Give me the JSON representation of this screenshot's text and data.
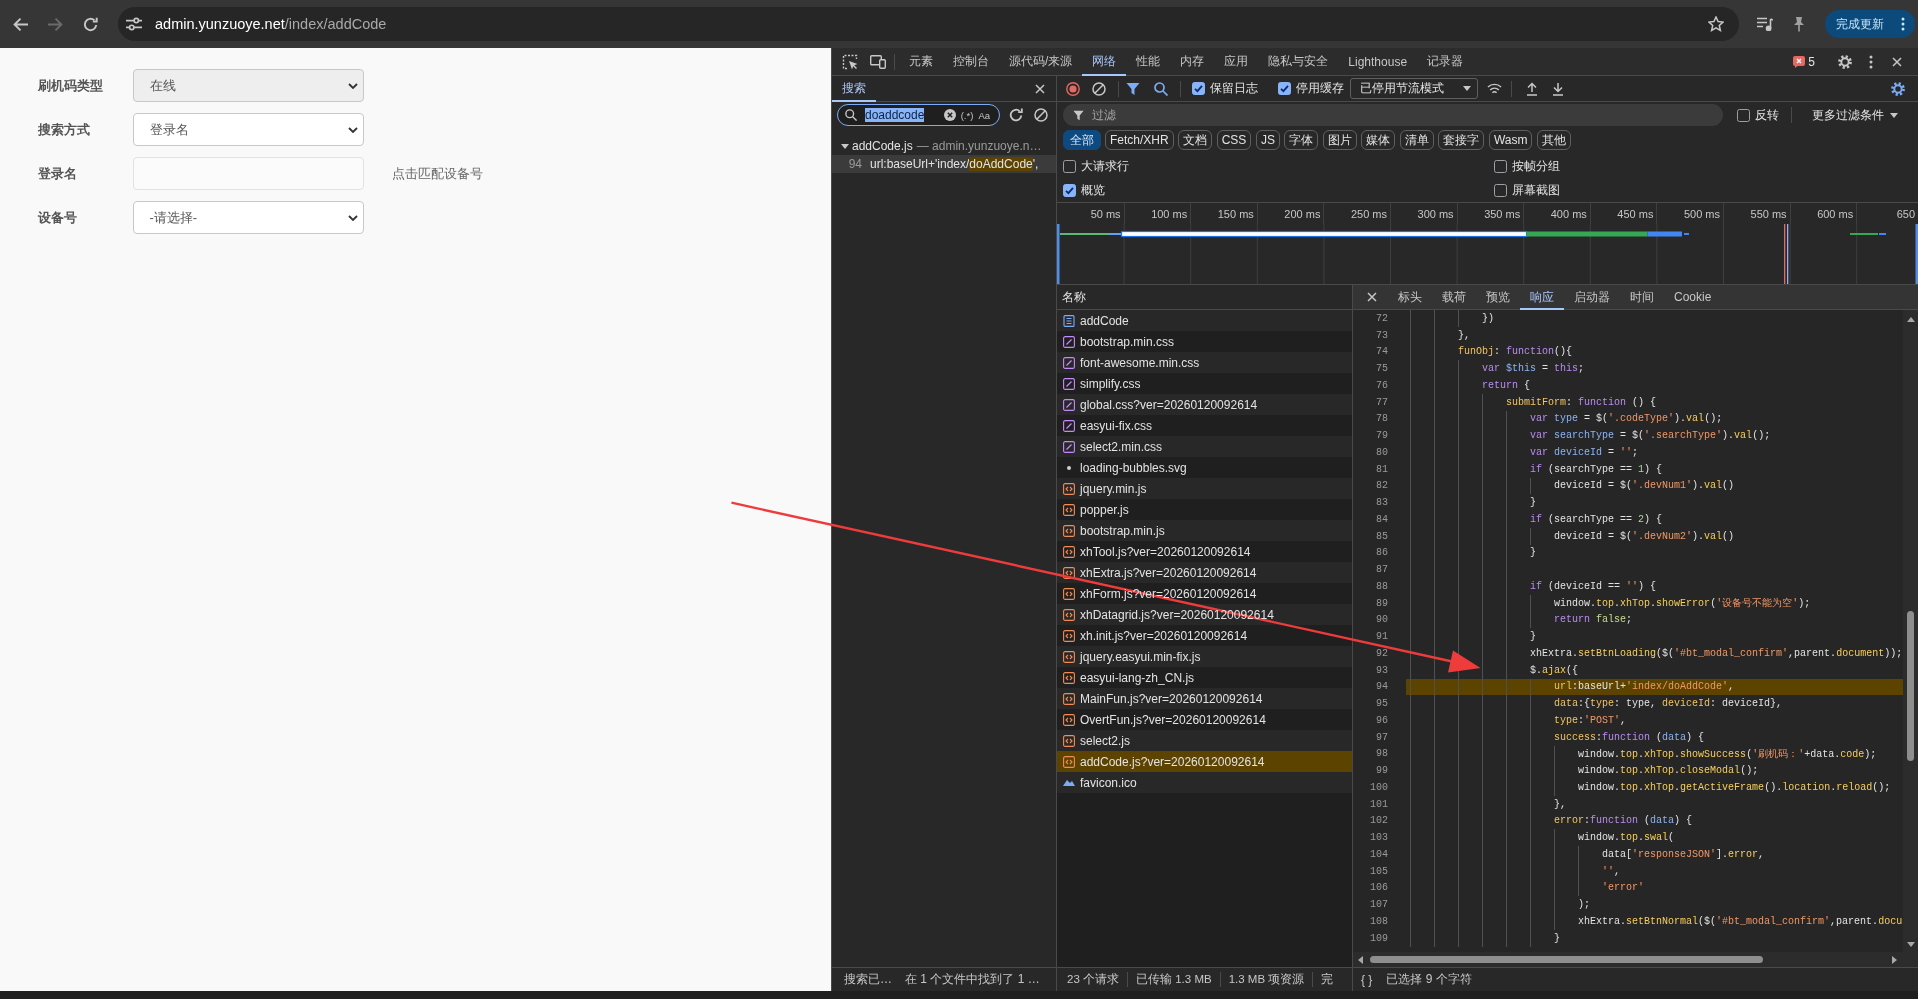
{
  "browser": {
    "nav_buttons": [
      {
        "kind": "back",
        "disabled": false
      },
      {
        "kind": "forward",
        "disabled": true
      },
      {
        "kind": "reload",
        "disabled": false
      }
    ],
    "address": {
      "host": "admin.yunzuoye.net",
      "path": "/index/addCode"
    },
    "update_button": "完成更新"
  },
  "page": {
    "form_rows": [
      {
        "kind": "select",
        "label": "刷机码类型",
        "value": "在线",
        "disabled": true
      },
      {
        "kind": "select",
        "label": "搜索方式",
        "value": "登录名",
        "disabled": false
      },
      {
        "kind": "input",
        "label": "登录名",
        "action": "点击匹配设备号"
      },
      {
        "kind": "select",
        "label": "设备号",
        "value": "-请选择-",
        "disabled": false
      }
    ]
  },
  "devtools": {
    "tabs": [
      {
        "label": "元素",
        "selected": false
      },
      {
        "label": "控制台",
        "selected": false
      },
      {
        "label": "源代码/来源",
        "selected": false
      },
      {
        "label": "网络",
        "selected": true
      },
      {
        "label": "性能",
        "selected": false
      },
      {
        "label": "内存",
        "selected": false
      },
      {
        "label": "应用",
        "selected": false
      },
      {
        "label": "隐私与安全",
        "selected": false
      },
      {
        "label": "Lighthouse",
        "selected": false
      },
      {
        "label": "记录器",
        "selected": false
      }
    ],
    "issues_count": "5",
    "search": {
      "tabs": [
        {
          "label": "搜索",
          "selected": true
        }
      ],
      "query": "doaddcode",
      "query_selected": true,
      "regex_toggle": "(.*)",
      "case_toggle": "Aa",
      "results": [
        {
          "file": "addCode.js",
          "origin": "— admin.yunzuoye.n…",
          "expanded": true,
          "matches": [
            {
              "line": "94",
              "before": "url:baseUrl+'index/",
              "match": "doAddCode",
              "after": "',",
              "selected": true
            }
          ]
        }
      ],
      "status": "搜索已…",
      "summary": "在 1 个文件中找到了 1 …"
    },
    "network": {
      "toolbar": {
        "buttons": [
          {
            "kind": "record",
            "on": true
          },
          {
            "kind": "clear",
            "on": false
          },
          {
            "kind": "filter",
            "on": true
          },
          {
            "kind": "search",
            "on": true
          }
        ],
        "toggles": [
          {
            "label": "保留日志",
            "checked": true
          },
          {
            "label": "停用缓存",
            "checked": true
          }
        ],
        "throttling": "已停用节流模式"
      },
      "filter": {
        "placeholder": "过滤",
        "invert": {
          "label": "反转",
          "checked": false
        },
        "more_filters": "更多过滤条件"
      },
      "type_filters": [
        {
          "label": "全部",
          "selected": true
        },
        {
          "label": "Fetch/XHR",
          "selected": false
        },
        {
          "label": "文档",
          "selected": false
        },
        {
          "label": "CSS",
          "selected": false
        },
        {
          "label": "JS",
          "selected": false
        },
        {
          "label": "字体",
          "selected": false
        },
        {
          "label": "图片",
          "selected": false
        },
        {
          "label": "媒体",
          "selected": false
        },
        {
          "label": "清单",
          "selected": false
        },
        {
          "label": "套接字",
          "selected": false
        },
        {
          "label": "Wasm",
          "selected": false
        },
        {
          "label": "其他",
          "selected": false
        }
      ],
      "options": [
        {
          "label": "大请求行",
          "checked": false
        },
        {
          "label": "按帧分组",
          "checked": false
        },
        {
          "label": "概览",
          "checked": true
        },
        {
          "label": "屏幕截图",
          "checked": false
        }
      ],
      "overview": {
        "ticks": [
          "50 ms",
          "100 ms",
          "150 ms",
          "200 ms",
          "250 ms",
          "300 ms",
          "350 ms",
          "400 ms",
          "450 ms",
          "500 ms",
          "550 ms",
          "600 ms",
          "650"
        ]
      },
      "requests": {
        "column": "名称",
        "rows": [
          {
            "name": "addCode",
            "kind": "document",
            "selected": false
          },
          {
            "name": "bootstrap.min.css",
            "kind": "stylesheet",
            "selected": false
          },
          {
            "name": "font-awesome.min.css",
            "kind": "stylesheet",
            "selected": false
          },
          {
            "name": "simplify.css",
            "kind": "stylesheet",
            "selected": false
          },
          {
            "name": "global.css?ver=20260120092614",
            "kind": "stylesheet",
            "selected": false
          },
          {
            "name": "easyui-fix.css",
            "kind": "stylesheet",
            "selected": false
          },
          {
            "name": "select2.min.css",
            "kind": "stylesheet",
            "selected": false
          },
          {
            "name": "loading-bubbles.svg",
            "kind": "svg",
            "selected": false
          },
          {
            "name": "jquery.min.js",
            "kind": "script",
            "selected": false
          },
          {
            "name": "popper.js",
            "kind": "script",
            "selected": false
          },
          {
            "name": "bootstrap.min.js",
            "kind": "script",
            "selected": false
          },
          {
            "name": "xhTool.js?ver=20260120092614",
            "kind": "script",
            "selected": false
          },
          {
            "name": "xhExtra.js?ver=20260120092614",
            "kind": "script",
            "selected": false
          },
          {
            "name": "xhForm.js?ver=20260120092614",
            "kind": "script",
            "selected": false
          },
          {
            "name": "xhDatagrid.js?ver=20260120092614",
            "kind": "script",
            "selected": false
          },
          {
            "name": "xh.init.js?ver=20260120092614",
            "kind": "script",
            "selected": false
          },
          {
            "name": "jquery.easyui.min-fix.js",
            "kind": "script",
            "selected": false
          },
          {
            "name": "easyui-lang-zh_CN.js",
            "kind": "script",
            "selected": false
          },
          {
            "name": "MainFun.js?ver=20260120092614",
            "kind": "script",
            "selected": false
          },
          {
            "name": "OvertFun.js?ver=20260120092614",
            "kind": "script",
            "selected": false
          },
          {
            "name": "select2.js",
            "kind": "script",
            "selected": false
          },
          {
            "name": "addCode.js?ver=20260120092614",
            "kind": "script",
            "selected": true
          },
          {
            "name": "favicon.ico",
            "kind": "image",
            "selected": false
          }
        ]
      },
      "summary": [
        "23 个请求",
        "已传输 1.3 MB",
        "1.3 MB 项资源",
        "完"
      ],
      "detail": {
        "tabs": [
          {
            "label": "标头",
            "selected": false
          },
          {
            "label": "载荷",
            "selected": false
          },
          {
            "label": "预览",
            "selected": false
          },
          {
            "label": "响应",
            "selected": true
          },
          {
            "label": "启动器",
            "selected": false
          },
          {
            "label": "时间",
            "selected": false
          },
          {
            "label": "Cookie",
            "selected": false
          }
        ],
        "code": [
          {
            "number": "72",
            "highlighted": false,
            "tokens": [
              {
                "kind": "plain",
                "text": "            })"
              }
            ]
          },
          {
            "number": "73",
            "highlighted": false,
            "tokens": [
              {
                "kind": "plain",
                "text": "        },"
              }
            ]
          },
          {
            "number": "74",
            "highlighted": false,
            "tokens": [
              {
                "kind": "prop",
                "text": "        funObj"
              },
              {
                "kind": "plain",
                "text": ": "
              },
              {
                "kind": "kw",
                "text": "function"
              },
              {
                "kind": "plain",
                "text": "(){"
              }
            ]
          },
          {
            "number": "75",
            "highlighted": false,
            "tokens": [
              {
                "kind": "kw",
                "text": "            var"
              },
              {
                "kind": "def",
                "text": " $this"
              },
              {
                "kind": "plain",
                "text": " = "
              },
              {
                "kind": "kw",
                "text": "this"
              },
              {
                "kind": "plain",
                "text": ";"
              }
            ]
          },
          {
            "number": "76",
            "highlighted": false,
            "tokens": [
              {
                "kind": "kw",
                "text": "            return"
              },
              {
                "kind": "plain",
                "text": " {"
              }
            ]
          },
          {
            "number": "77",
            "highlighted": false,
            "tokens": [
              {
                "kind": "prop",
                "text": "                submitForm"
              },
              {
                "kind": "plain",
                "text": ": "
              },
              {
                "kind": "kw",
                "text": "function"
              },
              {
                "kind": "plain",
                "text": " () {"
              }
            ]
          },
          {
            "number": "78",
            "highlighted": false,
            "tokens": [
              {
                "kind": "kw",
                "text": "                    var"
              },
              {
                "kind": "def",
                "text": " type"
              },
              {
                "kind": "plain",
                "text": " = $("
              },
              {
                "kind": "str",
                "text": "'.codeType'"
              },
              {
                "kind": "plain",
                "text": ")."
              },
              {
                "kind": "fn",
                "text": "val"
              },
              {
                "kind": "plain",
                "text": "();"
              }
            ]
          },
          {
            "number": "79",
            "highlighted": false,
            "tokens": [
              {
                "kind": "kw",
                "text": "                    var"
              },
              {
                "kind": "def",
                "text": " searchType"
              },
              {
                "kind": "plain",
                "text": " = $("
              },
              {
                "kind": "str",
                "text": "'.searchType'"
              },
              {
                "kind": "plain",
                "text": ")."
              },
              {
                "kind": "fn",
                "text": "val"
              },
              {
                "kind": "plain",
                "text": "();"
              }
            ]
          },
          {
            "number": "80",
            "highlighted": false,
            "tokens": [
              {
                "kind": "kw",
                "text": "                    var"
              },
              {
                "kind": "def",
                "text": " deviceId"
              },
              {
                "kind": "plain",
                "text": " = "
              },
              {
                "kind": "str",
                "text": "''"
              },
              {
                "kind": "plain",
                "text": ";"
              }
            ]
          },
          {
            "number": "81",
            "highlighted": false,
            "tokens": [
              {
                "kind": "kw",
                "text": "                    if"
              },
              {
                "kind": "plain",
                "text": " (searchType == "
              },
              {
                "kind": "num",
                "text": "1"
              },
              {
                "kind": "plain",
                "text": ") {"
              }
            ]
          },
          {
            "number": "82",
            "highlighted": false,
            "tokens": [
              {
                "kind": "plain",
                "text": "                        deviceId = $("
              },
              {
                "kind": "str",
                "text": "'.devNum1'"
              },
              {
                "kind": "plain",
                "text": ")."
              },
              {
                "kind": "fn",
                "text": "val"
              },
              {
                "kind": "plain",
                "text": "()"
              }
            ]
          },
          {
            "number": "83",
            "highlighted": false,
            "tokens": [
              {
                "kind": "plain",
                "text": "                    }"
              }
            ]
          },
          {
            "number": "84",
            "highlighted": false,
            "tokens": [
              {
                "kind": "kw",
                "text": "                    if"
              },
              {
                "kind": "plain",
                "text": " (searchType == "
              },
              {
                "kind": "num",
                "text": "2"
              },
              {
                "kind": "plain",
                "text": ") {"
              }
            ]
          },
          {
            "number": "85",
            "highlighted": false,
            "tokens": [
              {
                "kind": "plain",
                "text": "                        deviceId = $("
              },
              {
                "kind": "str",
                "text": "'.devNum2'"
              },
              {
                "kind": "plain",
                "text": ")."
              },
              {
                "kind": "fn",
                "text": "val"
              },
              {
                "kind": "plain",
                "text": "()"
              }
            ]
          },
          {
            "number": "86",
            "highlighted": false,
            "tokens": [
              {
                "kind": "plain",
                "text": "                    }"
              }
            ]
          },
          {
            "number": "87",
            "highlighted": false
          },
          {
            "number": "88",
            "highlighted": false,
            "tokens": [
              {
                "kind": "kw",
                "text": "                    if"
              },
              {
                "kind": "plain",
                "text": " (deviceId == "
              },
              {
                "kind": "str",
                "text": "''"
              },
              {
                "kind": "plain",
                "text": ") {"
              }
            ]
          },
          {
            "number": "89",
            "highlighted": false,
            "tokens": [
              {
                "kind": "plain",
                "text": "                        window."
              },
              {
                "kind": "fn",
                "text": "top"
              },
              {
                "kind": "plain",
                "text": "."
              },
              {
                "kind": "fn",
                "text": "xhTop"
              },
              {
                "kind": "plain",
                "text": "."
              },
              {
                "kind": "fn",
                "text": "showError"
              },
              {
                "kind": "plain",
                "text": "("
              },
              {
                "kind": "str",
                "text": "'设备号不能为空'"
              },
              {
                "kind": "plain",
                "text": ");"
              }
            ]
          },
          {
            "number": "90",
            "highlighted": false,
            "tokens": [
              {
                "kind": "kw",
                "text": "                        return"
              },
              {
                "kind": "atom",
                "text": " false"
              },
              {
                "kind": "plain",
                "text": ";"
              }
            ]
          },
          {
            "number": "91",
            "highlighted": false,
            "tokens": [
              {
                "kind": "plain",
                "text": "                    }"
              }
            ]
          },
          {
            "number": "92",
            "highlighted": false,
            "tokens": [
              {
                "kind": "plain",
                "text": "                    xhExtra."
              },
              {
                "kind": "fn",
                "text": "setBtnLoading"
              },
              {
                "kind": "plain",
                "text": "($("
              },
              {
                "kind": "str",
                "text": "'#bt_modal_confirm'"
              },
              {
                "kind": "plain",
                "text": ",parent."
              },
              {
                "kind": "fn",
                "text": "document"
              },
              {
                "kind": "plain",
                "text": "));"
              }
            ]
          },
          {
            "number": "93",
            "highlighted": false,
            "tokens": [
              {
                "kind": "plain",
                "text": "                    $."
              },
              {
                "kind": "fn",
                "text": "ajax"
              },
              {
                "kind": "plain",
                "text": "({"
              }
            ]
          },
          {
            "number": "94",
            "highlighted": true,
            "tokens": [
              {
                "kind": "prop",
                "text": "                        url"
              },
              {
                "kind": "plain",
                "text": ":baseUrl+"
              },
              {
                "kind": "str",
                "text": "'index/doAddCode'"
              },
              {
                "kind": "plain",
                "text": ","
              }
            ]
          },
          {
            "number": "95",
            "highlighted": false,
            "tokens": [
              {
                "kind": "prop",
                "text": "                        data"
              },
              {
                "kind": "plain",
                "text": ":{"
              },
              {
                "kind": "prop",
                "text": "type"
              },
              {
                "kind": "plain",
                "text": ": type, "
              },
              {
                "kind": "prop",
                "text": "deviceId"
              },
              {
                "kind": "plain",
                "text": ": deviceId},"
              }
            ]
          },
          {
            "number": "96",
            "highlighted": false,
            "tokens": [
              {
                "kind": "prop",
                "text": "                        type"
              },
              {
                "kind": "plain",
                "text": ":"
              },
              {
                "kind": "str",
                "text": "'POST'"
              },
              {
                "kind": "plain",
                "text": ","
              }
            ]
          },
          {
            "number": "97",
            "highlighted": false,
            "tokens": [
              {
                "kind": "prop",
                "text": "                        success"
              },
              {
                "kind": "plain",
                "text": ":"
              },
              {
                "kind": "kw",
                "text": "function"
              },
              {
                "kind": "plain",
                "text": " ("
              },
              {
                "kind": "def",
                "text": "data"
              },
              {
                "kind": "plain",
                "text": ") {"
              }
            ]
          },
          {
            "number": "98",
            "highlighted": false,
            "tokens": [
              {
                "kind": "plain",
                "text": "                            window."
              },
              {
                "kind": "fn",
                "text": "top"
              },
              {
                "kind": "plain",
                "text": "."
              },
              {
                "kind": "fn",
                "text": "xhTop"
              },
              {
                "kind": "plain",
                "text": "."
              },
              {
                "kind": "fn",
                "text": "showSuccess"
              },
              {
                "kind": "plain",
                "text": "("
              },
              {
                "kind": "str",
                "text": "'刷机码：'"
              },
              {
                "kind": "plain",
                "text": "+data."
              },
              {
                "kind": "fn",
                "text": "code"
              },
              {
                "kind": "plain",
                "text": ");"
              }
            ]
          },
          {
            "number": "99",
            "highlighted": false,
            "tokens": [
              {
                "kind": "plain",
                "text": "                            window."
              },
              {
                "kind": "fn",
                "text": "top"
              },
              {
                "kind": "plain",
                "text": "."
              },
              {
                "kind": "fn",
                "text": "xhTop"
              },
              {
                "kind": "plain",
                "text": "."
              },
              {
                "kind": "fn",
                "text": "closeModal"
              },
              {
                "kind": "plain",
                "text": "();"
              }
            ]
          },
          {
            "number": "100",
            "highlighted": false,
            "tokens": [
              {
                "kind": "plain",
                "text": "                            window."
              },
              {
                "kind": "fn",
                "text": "top"
              },
              {
                "kind": "plain",
                "text": "."
              },
              {
                "kind": "fn",
                "text": "xhTop"
              },
              {
                "kind": "plain",
                "text": "."
              },
              {
                "kind": "fn",
                "text": "getActiveFrame"
              },
              {
                "kind": "plain",
                "text": "()."
              },
              {
                "kind": "fn",
                "text": "location"
              },
              {
                "kind": "plain",
                "text": "."
              },
              {
                "kind": "fn",
                "text": "reload"
              },
              {
                "kind": "plain",
                "text": "();"
              }
            ]
          },
          {
            "number": "101",
            "highlighted": false,
            "tokens": [
              {
                "kind": "plain",
                "text": "                        },"
              }
            ]
          },
          {
            "number": "102",
            "highlighted": false,
            "tokens": [
              {
                "kind": "prop",
                "text": "                        error"
              },
              {
                "kind": "plain",
                "text": ":"
              },
              {
                "kind": "kw",
                "text": "function"
              },
              {
                "kind": "plain",
                "text": " ("
              },
              {
                "kind": "def",
                "text": "data"
              },
              {
                "kind": "plain",
                "text": ") {"
              }
            ]
          },
          {
            "number": "103",
            "highlighted": false,
            "tokens": [
              {
                "kind": "plain",
                "text": "                            window."
              },
              {
                "kind": "fn",
                "text": "top"
              },
              {
                "kind": "plain",
                "text": "."
              },
              {
                "kind": "fn",
                "text": "swal"
              },
              {
                "kind": "plain",
                "text": "("
              }
            ]
          },
          {
            "number": "104",
            "highlighted": false,
            "tokens": [
              {
                "kind": "plain",
                "text": "                                data["
              },
              {
                "kind": "str",
                "text": "'responseJSON'"
              },
              {
                "kind": "plain",
                "text": "]."
              },
              {
                "kind": "fn",
                "text": "error"
              },
              {
                "kind": "plain",
                "text": ","
              }
            ]
          },
          {
            "number": "105",
            "highlighted": false,
            "tokens": [
              {
                "kind": "str",
                "text": "                                ''"
              },
              {
                "kind": "plain",
                "text": ","
              }
            ]
          },
          {
            "number": "106",
            "highlighted": false,
            "tokens": [
              {
                "kind": "str",
                "text": "                                'error'"
              }
            ]
          },
          {
            "number": "107",
            "highlighted": false,
            "tokens": [
              {
                "kind": "plain",
                "text": "                            );"
              }
            ]
          },
          {
            "number": "108",
            "highlighted": false,
            "tokens": [
              {
                "kind": "plain",
                "text": "                            xhExtra."
              },
              {
                "kind": "fn",
                "text": "setBtnNormal"
              },
              {
                "kind": "plain",
                "text": "($("
              },
              {
                "kind": "str",
                "text": "'#bt_modal_confirm'"
              },
              {
                "kind": "plain",
                "text": ",parent."
              },
              {
                "kind": "fn",
                "text": "docu"
              }
            ]
          },
          {
            "number": "109",
            "highlighted": false,
            "tokens": [
              {
                "kind": "plain",
                "text": "                        }"
              }
            ]
          }
        ],
        "format_toggle": "{ }",
        "selection_status": "已选择 9 个字符"
      }
    }
  }
}
